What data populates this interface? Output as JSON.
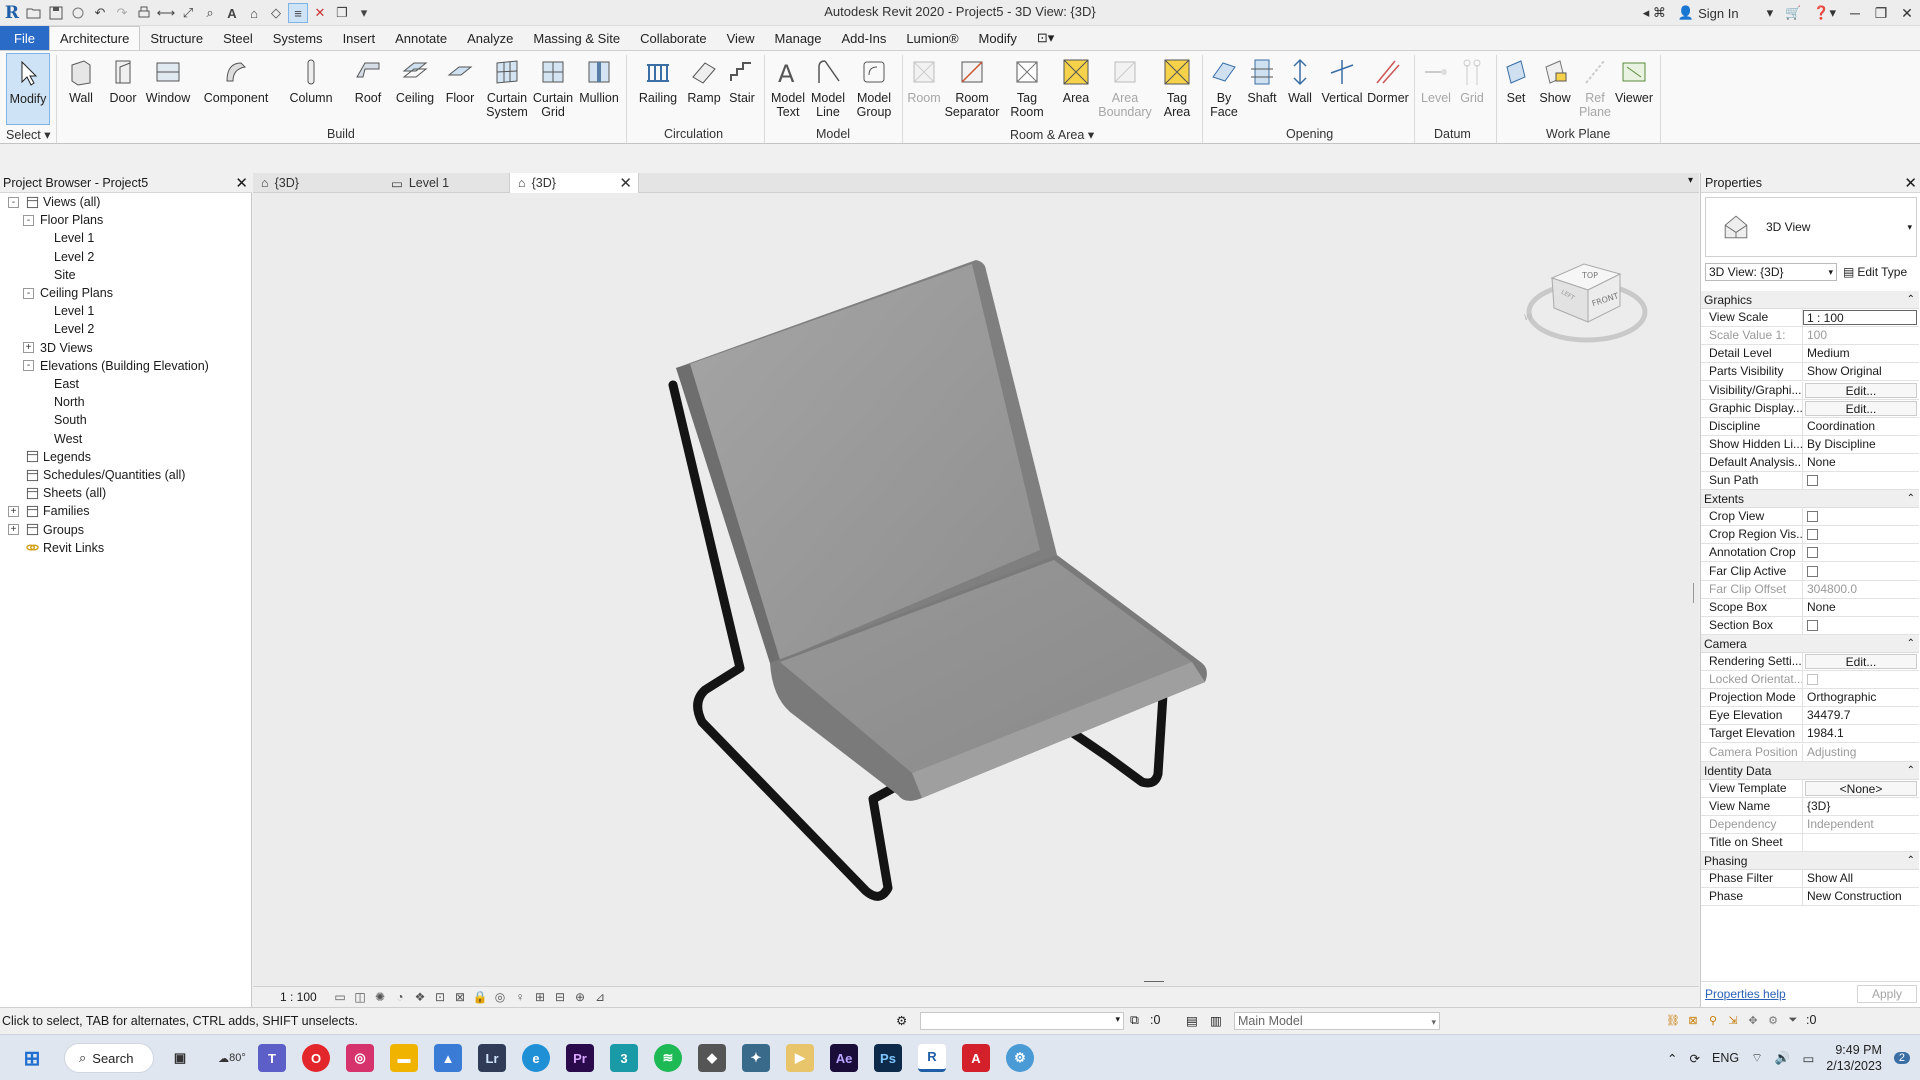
{
  "app": {
    "logo": "R",
    "title": "Autodesk Revit 2020 - Project5 - 3D View: {3D}",
    "sign_in": "Sign In"
  },
  "quick_access": [
    "open-icon",
    "save-icon",
    "sync-icon",
    "undo-icon",
    "redo-icon",
    "print-icon",
    "measure-icon",
    "dimension-icon",
    "tag-icon",
    "text-icon",
    "3d-view-icon",
    "section-icon",
    "thin-lines-icon",
    "close-hidden-icon",
    "switch-windows-icon",
    "customize-icon"
  ],
  "ribbon_tabs": [
    "File",
    "Architecture",
    "Structure",
    "Steel",
    "Systems",
    "Insert",
    "Annotate",
    "Analyze",
    "Massing & Site",
    "Collaborate",
    "View",
    "Manage",
    "Add-Ins",
    "Lumion®",
    "Modify"
  ],
  "active_tab": "Architecture",
  "ribbon": {
    "select": {
      "modify": "Modify",
      "label": "Select"
    },
    "build": {
      "label": "Build",
      "items": [
        "Wall",
        "Door",
        "Window",
        "Component",
        "Column",
        "Roof",
        "Ceiling",
        "Floor",
        "Curtain System",
        "Curtain Grid",
        "Mullion"
      ]
    },
    "circulation": {
      "label": "Circulation",
      "items": [
        "Railing",
        "Ramp",
        "Stair"
      ]
    },
    "model": {
      "label": "Model",
      "items": [
        "Model Text",
        "Model Line",
        "Model Group"
      ]
    },
    "room_area": {
      "label": "Room & Area",
      "items": [
        "Room",
        "Room Separator",
        "Tag Room",
        "Area",
        "Area Boundary",
        "Tag Area"
      ]
    },
    "opening": {
      "label": "Opening",
      "items": [
        "By Face",
        "Shaft",
        "Wall",
        "Vertical",
        "Dormer"
      ]
    },
    "datum": {
      "label": "Datum",
      "items": [
        "Level",
        "Grid"
      ]
    },
    "work_plane": {
      "label": "Work Plane",
      "items": [
        "Set",
        "Show",
        "Ref Plane",
        "Viewer"
      ]
    }
  },
  "project_browser": {
    "title": "Project Browser - Project5",
    "tree": [
      {
        "label": "Views (all)",
        "level": 0,
        "exp": "-"
      },
      {
        "label": "Floor Plans",
        "level": 1,
        "exp": "-"
      },
      {
        "label": "Level 1",
        "level": 2
      },
      {
        "label": "Level 2",
        "level": 2
      },
      {
        "label": "Site",
        "level": 2
      },
      {
        "label": "Ceiling Plans",
        "level": 1,
        "exp": "-"
      },
      {
        "label": "Level 1",
        "level": 2
      },
      {
        "label": "Level 2",
        "level": 2
      },
      {
        "label": "3D Views",
        "level": 1,
        "exp": "+"
      },
      {
        "label": "Elevations (Building Elevation)",
        "level": 1,
        "exp": "-"
      },
      {
        "label": "East",
        "level": 2
      },
      {
        "label": "North",
        "level": 2
      },
      {
        "label": "South",
        "level": 2
      },
      {
        "label": "West",
        "level": 2
      },
      {
        "label": "Legends",
        "level": 0
      },
      {
        "label": "Schedules/Quantities (all)",
        "level": 0
      },
      {
        "label": "Sheets (all)",
        "level": 0
      },
      {
        "label": "Families",
        "level": 0,
        "exp": "+"
      },
      {
        "label": "Groups",
        "level": 0,
        "exp": "+"
      },
      {
        "label": "Revit Links",
        "level": 0
      }
    ]
  },
  "doc_tabs": [
    "{3D}",
    "Level 1",
    "{3D}"
  ],
  "viewcube": {
    "top": "TOP",
    "front": "FRONT",
    "left": "LEFT"
  },
  "view_control": {
    "scale": "1 : 100"
  },
  "properties": {
    "title": "Properties",
    "type_name": "3D View",
    "instance": "3D View: {3D}",
    "edit_type": "Edit Type",
    "groups": [
      {
        "name": "Graphics",
        "rows": [
          {
            "label": "View Scale",
            "value": "1 : 100",
            "kind": "boxed"
          },
          {
            "label": "Scale Value    1:",
            "value": "100",
            "dim": true
          },
          {
            "label": "Detail Level",
            "value": "Medium"
          },
          {
            "label": "Parts Visibility",
            "value": "Show Original"
          },
          {
            "label": "Visibility/Graphi...",
            "value": "Edit...",
            "kind": "btn"
          },
          {
            "label": "Graphic Display...",
            "value": "Edit...",
            "kind": "btn"
          },
          {
            "label": "Discipline",
            "value": "Coordination"
          },
          {
            "label": "Show Hidden Li...",
            "value": "By Discipline"
          },
          {
            "label": "Default Analysis...",
            "value": "None"
          },
          {
            "label": "Sun Path",
            "value": "",
            "kind": "check"
          }
        ]
      },
      {
        "name": "Extents",
        "rows": [
          {
            "label": "Crop View",
            "value": "",
            "kind": "check"
          },
          {
            "label": "Crop Region Vis...",
            "value": "",
            "kind": "check"
          },
          {
            "label": "Annotation Crop",
            "value": "",
            "kind": "check"
          },
          {
            "label": "Far Clip Active",
            "value": "",
            "kind": "check"
          },
          {
            "label": "Far Clip Offset",
            "value": "304800.0",
            "dim": true
          },
          {
            "label": "Scope Box",
            "value": "None"
          },
          {
            "label": "Section Box",
            "value": "",
            "kind": "check"
          }
        ]
      },
      {
        "name": "Camera",
        "rows": [
          {
            "label": "Rendering Setti...",
            "value": "Edit...",
            "kind": "btn"
          },
          {
            "label": "Locked Orientat...",
            "value": "",
            "kind": "check",
            "dim": true
          },
          {
            "label": "Projection Mode",
            "value": "Orthographic"
          },
          {
            "label": "Eye Elevation",
            "value": "34479.7"
          },
          {
            "label": "Target Elevation",
            "value": "1984.1"
          },
          {
            "label": "Camera Position",
            "value": "Adjusting",
            "dim": true
          }
        ]
      },
      {
        "name": "Identity Data",
        "rows": [
          {
            "label": "View Template",
            "value": "<None>",
            "kind": "btn"
          },
          {
            "label": "View Name",
            "value": "{3D}"
          },
          {
            "label": "Dependency",
            "value": "Independent",
            "dim": true
          },
          {
            "label": "Title on Sheet",
            "value": ""
          }
        ]
      },
      {
        "name": "Phasing",
        "rows": [
          {
            "label": "Phase Filter",
            "value": "Show All"
          },
          {
            "label": "Phase",
            "value": "New Construction"
          }
        ]
      }
    ],
    "help": "Properties help",
    "apply": "Apply"
  },
  "status": {
    "message": "Click to select, TAB for alternates, CTRL adds, SHIFT unselects.",
    "zero": ":0",
    "model": "Main Model",
    "filter_count": ":0"
  },
  "taskbar": {
    "search": "Search",
    "weather": "80°",
    "apps": [
      "file-explorer-icon",
      "opera-icon",
      "instagram-icon",
      "folder-icon",
      "photos-icon",
      "lightroom-icon",
      "edge-icon",
      "premiere-icon",
      "3dsmax-icon",
      "spotify-icon",
      "app-icon",
      "app-icon-2",
      "media-icon",
      "after-effects-icon",
      "photoshop-icon",
      "revit-icon",
      "autocad-icon",
      "settings-icon"
    ],
    "lang": "ENG",
    "time": "9:49 PM",
    "date": "2/13/2023",
    "notifications": "2"
  },
  "colors": {
    "accent": "#2a6bc7",
    "chair_surface": "#9a9a9a",
    "chair_frame": "#141414",
    "viewport_bg": "#ececec"
  }
}
